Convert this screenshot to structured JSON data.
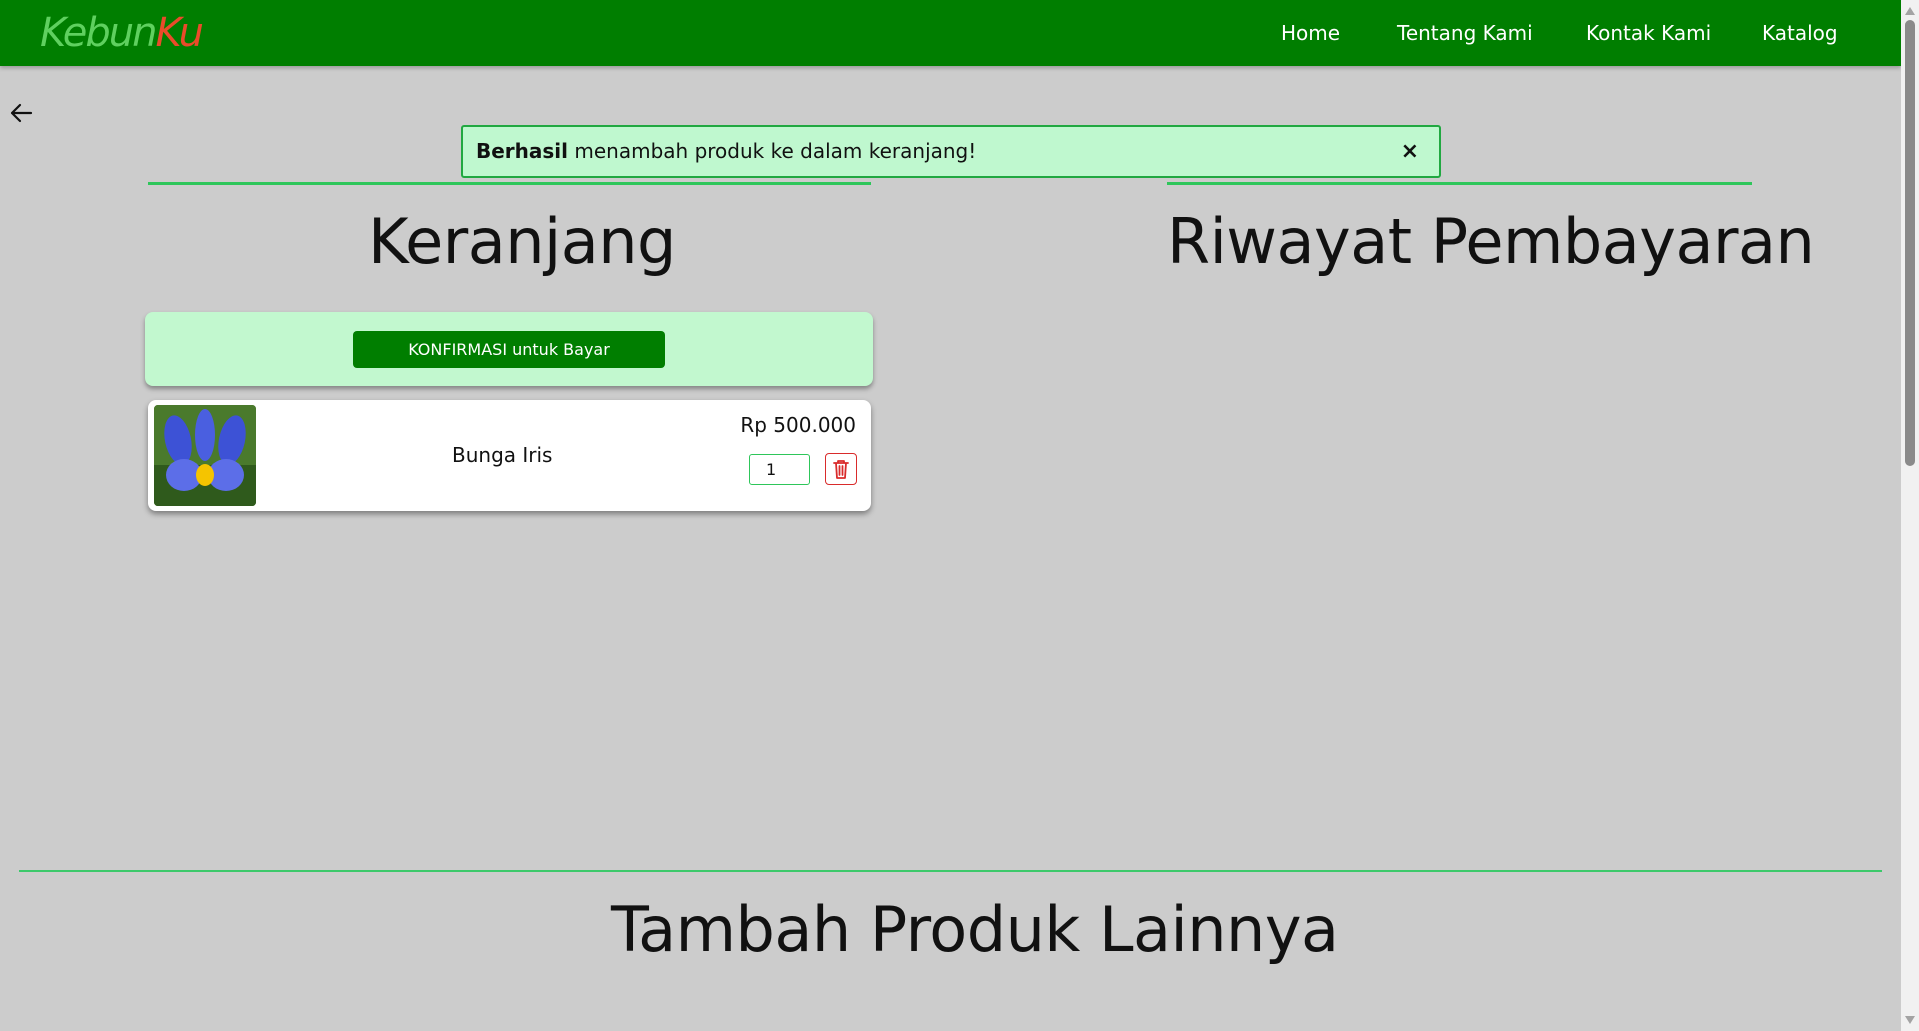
{
  "navbar": {
    "brand_part1": "Kebun",
    "brand_part2": "Ku",
    "links": [
      "Home",
      "Tentang Kami",
      "Kontak Kami",
      "Katalog"
    ]
  },
  "alert": {
    "bold": "Berhasil",
    "message": " menambah produk ke dalam keranjang!",
    "close": "×"
  },
  "cart": {
    "title": "Keranjang",
    "confirm_label": "KONFIRMASI untuk Bayar",
    "items": [
      {
        "name": "Bunga Iris",
        "price": "Rp 500.000",
        "quantity": "1"
      }
    ]
  },
  "history": {
    "title": "Riwayat Pembayaran"
  },
  "more": {
    "title": "Tambah Produk Lainnya"
  },
  "colors": {
    "navbar": "#007e00",
    "accent_green": "#2ec65a",
    "panel_green": "#c2f8cf",
    "delete_red": "#d92b2b"
  },
  "icons": [
    "back-arrow-icon",
    "close-icon",
    "trash-icon"
  ]
}
